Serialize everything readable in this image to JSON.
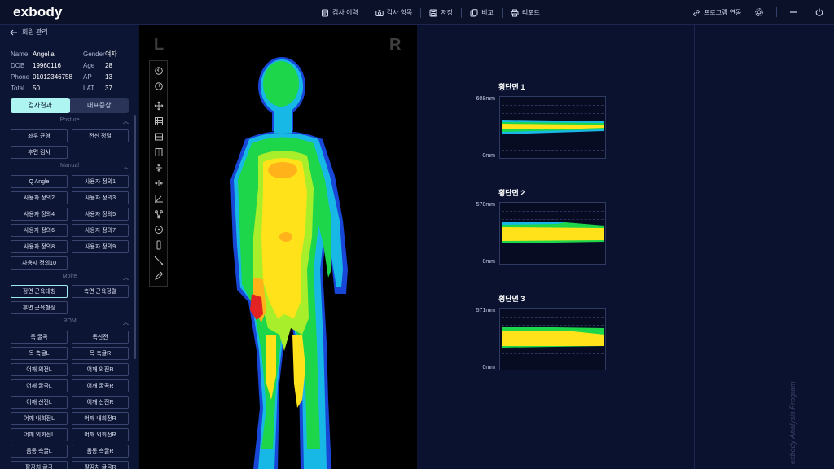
{
  "app": {
    "logo": "exbody"
  },
  "topnav": {
    "items": [
      {
        "label": "검사 이력",
        "icon": "history-icon"
      },
      {
        "label": "검사 항목",
        "icon": "camera-icon"
      },
      {
        "label": "저장",
        "icon": "save-icon"
      },
      {
        "label": "비교",
        "icon": "compare-icon"
      },
      {
        "label": "리포트",
        "icon": "print-icon"
      }
    ],
    "link_label": "프로그램 연동"
  },
  "sidebar": {
    "back_label": "회원 관리",
    "info": {
      "name_key": "Name",
      "name": "Angella",
      "gender_key": "Gender",
      "gender": "여자",
      "dob_key": "DOB",
      "dob": "19960116",
      "age_key": "Age",
      "age": "28",
      "phone_key": "Phone",
      "phone": "01012346758",
      "ap_key": "AP",
      "ap": "13",
      "total_key": "Total",
      "total": "50",
      "lat_key": "LAT",
      "lat": "37"
    },
    "tabs": [
      "검사결과",
      "대표증상"
    ],
    "sections": {
      "posture": "Posture",
      "manual": "Manual",
      "moire": "Moire",
      "rom": "ROM"
    },
    "posture_buttons": [
      "좌우 균형",
      "전신 정렬",
      "후면 검사"
    ],
    "manual_buttons": [
      "Q Angle",
      "사용자 정의1",
      "사용자 정의2",
      "사용자 정의3",
      "사용자 정의4",
      "사용자 정의5",
      "사용자 정의6",
      "사용자 정의7",
      "사용자 정의8",
      "사용자 정의9",
      "사용자 정의10"
    ],
    "moire_buttons": [
      "정면 근육대칭",
      "측면 근육정렬",
      "후면 근육형상"
    ],
    "rom_buttons": [
      "목 굴곡",
      "목신전",
      "목 측굴L",
      "목 측굴R",
      "어깨 외전L",
      "어깨 외전R",
      "어깨 굴곡L",
      "어깨 굴곡R",
      "어깨 신전L",
      "어깨 신전R",
      "어깨 내회전L",
      "어깨 내회전R",
      "어깨 외회전L",
      "어깨 외회전R",
      "몸통 측굴L",
      "몸통 측굴R",
      "팔꿈치 굴곡",
      "팔꿈치 굴곡R"
    ]
  },
  "viewer": {
    "left_label": "L",
    "right_label": "R"
  },
  "sections": [
    {
      "title": "횡단면 1",
      "top_label": "608mm",
      "bottom_label": "0mm"
    },
    {
      "title": "횡단면 2",
      "top_label": "578mm",
      "bottom_label": "0mm"
    },
    {
      "title": "횡단면 3",
      "top_label": "571mm",
      "bottom_label": "0mm"
    }
  ],
  "watermark": "exbody Analysis Program",
  "colors": {
    "accent": "#aef4f0",
    "background": "#0b1230",
    "heat_red": "#e32222",
    "heat_yellow": "#ffe21a",
    "heat_green": "#1ed64a",
    "heat_cyan": "#18b8e6",
    "heat_blue": "#1846d6"
  }
}
